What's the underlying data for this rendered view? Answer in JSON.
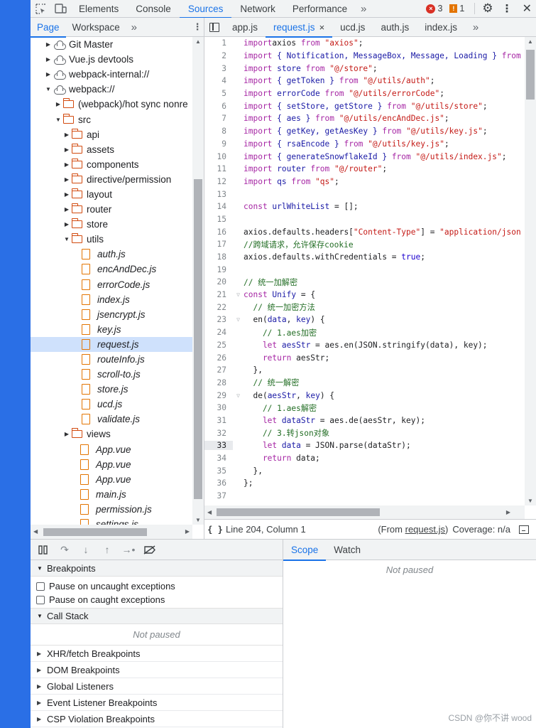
{
  "toolbar": {
    "panels": [
      "Elements",
      "Console",
      "Sources",
      "Network",
      "Performance"
    ],
    "active_panel": "Sources",
    "error_count": "3",
    "warning_count": "1"
  },
  "navigator": {
    "tabs": [
      "Page",
      "Workspace"
    ],
    "active_tab": "Page",
    "tree": [
      {
        "label": "Git Master",
        "type": "cloud",
        "depth": 0,
        "arrow": "right"
      },
      {
        "label": "Vue.js devtools",
        "type": "cloud",
        "depth": 0,
        "arrow": "right"
      },
      {
        "label": "webpack-internal://",
        "type": "cloud",
        "depth": 0,
        "arrow": "right"
      },
      {
        "label": "webpack://",
        "type": "cloud",
        "depth": 0,
        "arrow": "down"
      },
      {
        "label": "(webpack)/hot sync nonre",
        "type": "folder",
        "depth": 1,
        "arrow": "right"
      },
      {
        "label": "src",
        "type": "folder",
        "depth": 1,
        "arrow": "down"
      },
      {
        "label": "api",
        "type": "folder",
        "depth": 2,
        "arrow": "right"
      },
      {
        "label": "assets",
        "type": "folder",
        "depth": 2,
        "arrow": "right"
      },
      {
        "label": "components",
        "type": "folder",
        "depth": 2,
        "arrow": "right"
      },
      {
        "label": "directive/permission",
        "type": "folder",
        "depth": 2,
        "arrow": "right"
      },
      {
        "label": "layout",
        "type": "folder",
        "depth": 2,
        "arrow": "right"
      },
      {
        "label": "router",
        "type": "folder",
        "depth": 2,
        "arrow": "right"
      },
      {
        "label": "store",
        "type": "folder",
        "depth": 2,
        "arrow": "right"
      },
      {
        "label": "utils",
        "type": "folder",
        "depth": 2,
        "arrow": "down"
      },
      {
        "label": "auth.js",
        "type": "file",
        "depth": 3
      },
      {
        "label": "encAndDec.js",
        "type": "file",
        "depth": 3
      },
      {
        "label": "errorCode.js",
        "type": "file",
        "depth": 3
      },
      {
        "label": "index.js",
        "type": "file",
        "depth": 3
      },
      {
        "label": "jsencrypt.js",
        "type": "file",
        "depth": 3
      },
      {
        "label": "key.js",
        "type": "file",
        "depth": 3
      },
      {
        "label": "request.js",
        "type": "file",
        "depth": 3,
        "selected": true
      },
      {
        "label": "routeInfo.js",
        "type": "file",
        "depth": 3
      },
      {
        "label": "scroll-to.js",
        "type": "file",
        "depth": 3
      },
      {
        "label": "store.js",
        "type": "file",
        "depth": 3
      },
      {
        "label": "ucd.js",
        "type": "file",
        "depth": 3
      },
      {
        "label": "validate.js",
        "type": "file",
        "depth": 3
      },
      {
        "label": "views",
        "type": "folder",
        "depth": 2,
        "arrow": "right"
      },
      {
        "label": "App.vue",
        "type": "file",
        "depth": 2
      },
      {
        "label": "App.vue",
        "type": "file",
        "depth": 2
      },
      {
        "label": "App.vue",
        "type": "file",
        "depth": 2
      },
      {
        "label": "main.js",
        "type": "file",
        "depth": 2
      },
      {
        "label": "permission.js",
        "type": "file",
        "depth": 2
      },
      {
        "label": "settings.js",
        "type": "file",
        "depth": 2
      }
    ]
  },
  "editor": {
    "tabs": [
      "app.js",
      "request.js",
      "ucd.js",
      "auth.js",
      "index.js"
    ],
    "active_tab": "request.js",
    "current_line": 33,
    "lines": [
      [
        [
          "kw",
          "import"
        ],
        [
          "",
          "axios "
        ],
        [
          "kw",
          "from"
        ],
        [
          "str",
          " \"axios\""
        ],
        [
          "",
          ";"
        ]
      ],
      [
        [
          "kw",
          "import"
        ],
        [
          "vd",
          " { Notification, MessageBox, Message, Loading } "
        ],
        [
          "kw",
          "from"
        ]
      ],
      [
        [
          "kw",
          "import"
        ],
        [
          "vd",
          " store "
        ],
        [
          "kw",
          "from"
        ],
        [
          "str",
          " \"@/store\""
        ],
        [
          "",
          ";"
        ]
      ],
      [
        [
          "kw",
          "import"
        ],
        [
          "vd",
          " { getToken } "
        ],
        [
          "kw",
          "from"
        ],
        [
          "str",
          " \"@/utils/auth\""
        ],
        [
          "",
          ";"
        ]
      ],
      [
        [
          "kw",
          "import"
        ],
        [
          "vd",
          " errorCode "
        ],
        [
          "kw",
          "from"
        ],
        [
          "str",
          " \"@/utils/errorCode\""
        ],
        [
          "",
          ";"
        ]
      ],
      [
        [
          "kw",
          "import"
        ],
        [
          "vd",
          " { setStore, getStore } "
        ],
        [
          "kw",
          "from"
        ],
        [
          "str",
          " \"@/utils/store\""
        ],
        [
          "",
          ";"
        ]
      ],
      [
        [
          "kw",
          "import"
        ],
        [
          "vd",
          " { aes } "
        ],
        [
          "kw",
          "from"
        ],
        [
          "str",
          " \"@/utils/encAndDec.js\""
        ],
        [
          "",
          ";"
        ]
      ],
      [
        [
          "kw",
          "import"
        ],
        [
          "vd",
          " { getKey, getAesKey } "
        ],
        [
          "kw",
          "from"
        ],
        [
          "str",
          " \"@/utils/key.js\""
        ],
        [
          "",
          ";"
        ]
      ],
      [
        [
          "kw",
          "import"
        ],
        [
          "vd",
          " { rsaEncode } "
        ],
        [
          "kw",
          "from"
        ],
        [
          "str",
          " \"@/utils/key.js\""
        ],
        [
          "",
          ";"
        ]
      ],
      [
        [
          "kw",
          "import"
        ],
        [
          "vd",
          " { generateSnowflakeId } "
        ],
        [
          "kw",
          "from"
        ],
        [
          "str",
          " \"@/utils/index.js\""
        ],
        [
          "",
          ";"
        ]
      ],
      [
        [
          "kw",
          "import"
        ],
        [
          "vd",
          " router "
        ],
        [
          "kw",
          "from"
        ],
        [
          "str",
          " \"@/router\""
        ],
        [
          "",
          ";"
        ]
      ],
      [
        [
          "kw",
          "import"
        ],
        [
          "vd",
          " qs "
        ],
        [
          "kw",
          "from"
        ],
        [
          "str",
          " \"qs\""
        ],
        [
          "",
          ";"
        ]
      ],
      [],
      [
        [
          "kw",
          "const"
        ],
        [
          "vd",
          " urlWhiteList"
        ],
        [
          "",
          " = [];"
        ]
      ],
      [],
      [
        [
          "",
          "axios.defaults.headers["
        ],
        [
          "str",
          "\"Content-Type\""
        ],
        [
          "",
          "] = "
        ],
        [
          "str",
          "\"application/json"
        ]
      ],
      [
        [
          "cm",
          "//跨域请求，允许保存cookie"
        ]
      ],
      [
        [
          "",
          "axios.defaults.withCredentials = "
        ],
        [
          "fn",
          "true"
        ],
        [
          "",
          ";"
        ]
      ],
      [],
      [
        [
          "cm",
          "// 统一加解密"
        ]
      ],
      [
        [
          "kw",
          "const"
        ],
        [
          "vd",
          " Unify"
        ],
        [
          "",
          " = {"
        ]
      ],
      [
        [
          "cm",
          "  // 统一加密方法"
        ]
      ],
      [
        [
          "",
          "  en("
        ],
        [
          "vd",
          "data"
        ],
        [
          "",
          ", "
        ],
        [
          "vd",
          "key"
        ],
        [
          "",
          ") {"
        ]
      ],
      [
        [
          "cm",
          "    // 1.aes加密"
        ]
      ],
      [
        [
          "kw",
          "    let"
        ],
        [
          "vd",
          " aesStr"
        ],
        [
          "",
          " = aes.en(JSON.stringify(data), key);"
        ]
      ],
      [
        [
          "kw",
          "    return"
        ],
        [
          "",
          " aesStr;"
        ]
      ],
      [
        [
          "",
          "  },"
        ]
      ],
      [
        [
          "cm",
          "  // 统一解密"
        ]
      ],
      [
        [
          "",
          "  de("
        ],
        [
          "vd",
          "aesStr"
        ],
        [
          "",
          ", "
        ],
        [
          "vd",
          "key"
        ],
        [
          "",
          ") {"
        ]
      ],
      [
        [
          "cm",
          "    // 1.aes解密"
        ]
      ],
      [
        [
          "kw",
          "    let"
        ],
        [
          "vd",
          " dataStr"
        ],
        [
          "",
          " = aes.de(aesStr, key);"
        ]
      ],
      [
        [
          "cm",
          "    // 3.转json对象"
        ]
      ],
      [
        [
          "kw",
          "    let"
        ],
        [
          "vd",
          " data"
        ],
        [
          "",
          " = JSON.parse(dataStr);"
        ]
      ],
      [
        [
          "kw",
          "    return"
        ],
        [
          "",
          " data;"
        ]
      ],
      [
        [
          "",
          "  },"
        ]
      ],
      [
        [
          "",
          "};"
        ]
      ],
      []
    ]
  },
  "status": {
    "braces": "{ }",
    "position": "Line 204, Column 1",
    "from_prefix": "(From ",
    "from_file": "request.js",
    "from_suffix": ")",
    "coverage": "Coverage: n/a"
  },
  "debugger": {
    "breakpoints_label": "Breakpoints",
    "pause_uncaught": "Pause on uncaught exceptions",
    "pause_caught": "Pause on caught exceptions",
    "call_stack_label": "Call Stack",
    "not_paused": "Not paused",
    "collapsed_sections": [
      "XHR/fetch Breakpoints",
      "DOM Breakpoints",
      "Global Listeners",
      "Event Listener Breakpoints",
      "CSP Violation Breakpoints"
    ]
  },
  "scope": {
    "tabs": [
      "Scope",
      "Watch"
    ],
    "active_tab": "Scope",
    "not_paused": "Not paused"
  },
  "watermark": "CSDN @你不讲 wood"
}
